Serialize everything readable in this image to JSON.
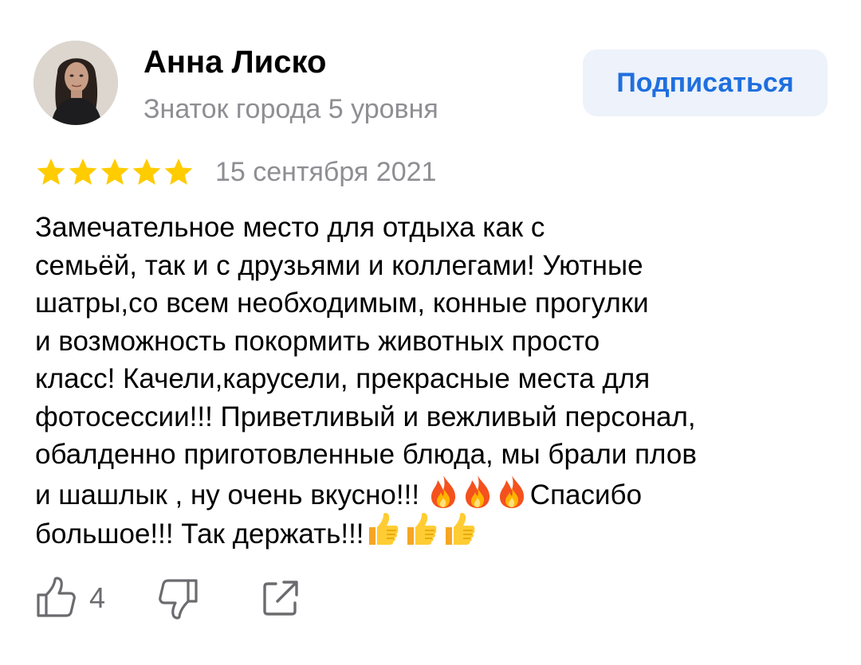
{
  "author": {
    "name": "Анна Лиско",
    "level": "Знаток города 5 уровня",
    "avatar_icon": "user-photo"
  },
  "subscribe_button": {
    "label": "Подписаться",
    "background": "#edf2fb",
    "text_color": "#1f6fde"
  },
  "review": {
    "rating": 5,
    "rating_max": 5,
    "star_color": "#ffcc00",
    "date": "15 сентября 2021",
    "lines": [
      "Замечательное место для отдыха как с",
      "семьёй, так и с друзьями и коллегами! Уютные",
      "шатры,со всем необходимым, конные прогулки",
      "и возможность покормить животных просто",
      "класс! Качели,карусели, прекрасные места для",
      "фотосессии!!! Приветливый и вежливый персонал,",
      "обалденно приготовленные блюда,  мы брали плов",
      "и шашлык , ну очень вкусно!!! ",
      "Спасибо",
      "большое!!! Так держать!!!"
    ],
    "emojis": {
      "fire": "fire-emoji",
      "thumbs_up": "thumbs-up-emoji"
    }
  },
  "actions": {
    "like_icon": "thumbs-up-outline-icon",
    "like_count": "4",
    "dislike_icon": "thumbs-down-outline-icon",
    "share_icon": "share-icon"
  },
  "colors": {
    "secondary_text": "#8e8e93",
    "icon_gray": "#6b6b6f"
  }
}
